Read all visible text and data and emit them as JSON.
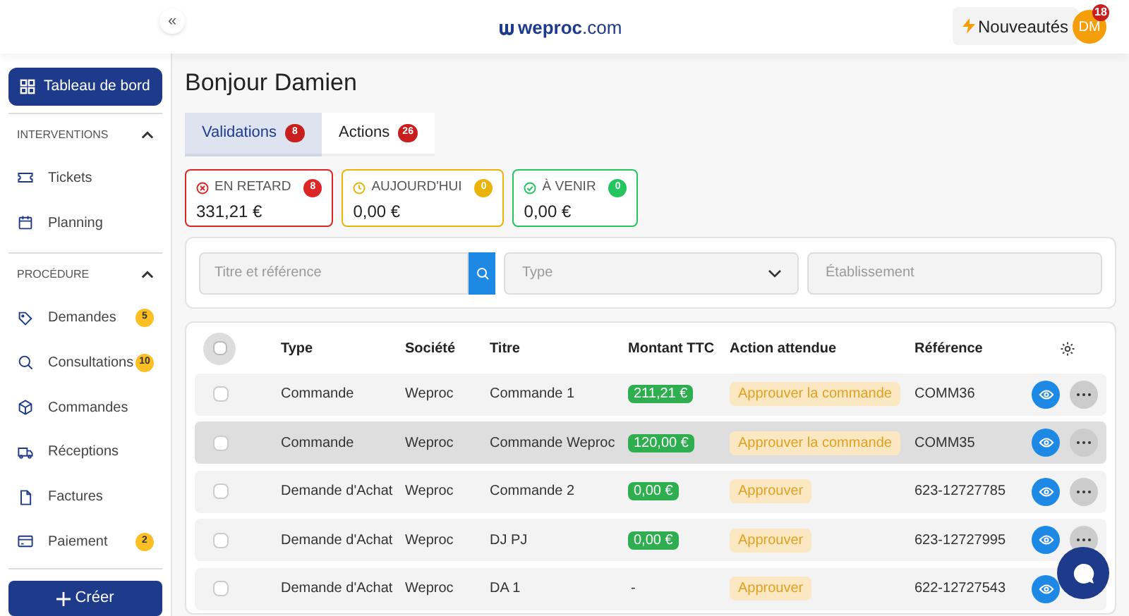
{
  "header": {
    "collapse_label": "«",
    "logo_text": "weproc",
    "logo_domain": ".com",
    "news_button": "Nouveautés",
    "avatar_initials": "DM",
    "avatar_badge": "18"
  },
  "sidebar": {
    "primary": {
      "label": "Tableau de bord",
      "selected": true
    },
    "sections": [
      {
        "title": "INTERVENTIONS",
        "expanded": true,
        "items": [
          {
            "kind": "ticket",
            "label": "Tickets",
            "selected": false
          },
          {
            "kind": "calendar",
            "label": "Planning",
            "selected": false
          }
        ]
      },
      {
        "title": "PROCÉDURE",
        "expanded": true,
        "items": [
          {
            "kind": "tag",
            "label": "Demandes",
            "badge": "5",
            "selected": false
          },
          {
            "kind": "search",
            "label": "Consultations",
            "badge": "10",
            "selected": false
          },
          {
            "kind": "box",
            "label": "Commandes",
            "selected": false
          },
          {
            "kind": "truck",
            "label": "Réceptions",
            "selected": false
          },
          {
            "kind": "file",
            "label": "Factures",
            "selected": false
          },
          {
            "kind": "card",
            "label": "Paiement",
            "badge": "2",
            "selected": false
          }
        ]
      }
    ],
    "create_button": "Créer"
  },
  "greeting": "Bonjour Damien",
  "tabs": [
    {
      "label": "Validations",
      "count": "8",
      "selected": true
    },
    {
      "label": "Actions",
      "count": "26",
      "selected": false
    }
  ],
  "summary_cards": [
    {
      "kind": "late",
      "label": "EN RETARD",
      "count": "8",
      "amount": "331,21 €",
      "color": "#dc2626"
    },
    {
      "kind": "today",
      "label": "AUJOURD'HUI",
      "count": "0",
      "amount": "0,00 €",
      "color": "#eab308"
    },
    {
      "kind": "upcoming",
      "label": "À VENIR",
      "count": "0",
      "amount": "0,00 €",
      "color": "#22c55e"
    }
  ],
  "filters": {
    "search_placeholder": "Titre et référence",
    "type_placeholder": "Type",
    "establishment_placeholder": "Établissement"
  },
  "table": {
    "select_all": {
      "checked": false
    },
    "columns": [
      "Type",
      "Société",
      "Titre",
      "Montant TTC",
      "Action attendue",
      "Référence"
    ],
    "rows": [
      {
        "checked": false,
        "highlighted": false,
        "type": "Commande",
        "company": "Weproc",
        "title": "Commande 1",
        "amount": "211,21 €",
        "amount_badge": true,
        "action": "Approuver la commande",
        "reference": "COMM36",
        "has_menu": true
      },
      {
        "checked": false,
        "highlighted": true,
        "type": "Commande",
        "company": "Weproc",
        "title": "Commande Weproc",
        "amount": "120,00 €",
        "amount_badge": true,
        "action": "Approuver la commande",
        "reference": "COMM35",
        "has_menu": true
      },
      {
        "checked": false,
        "highlighted": false,
        "type": "Demande d'Achat",
        "company": "Weproc",
        "title": "Commande 2",
        "amount": "0,00 €",
        "amount_badge": true,
        "action": "Approuver",
        "reference": "623-12727785",
        "has_menu": true
      },
      {
        "checked": false,
        "highlighted": false,
        "type": "Demande d'Achat",
        "company": "Weproc",
        "title": "DJ PJ",
        "amount": "0,00 €",
        "amount_badge": true,
        "action": "Approuver",
        "reference": "623-12727995",
        "has_menu": true
      },
      {
        "checked": false,
        "highlighted": false,
        "type": "Demande d'Achat",
        "company": "Weproc",
        "title": "DA 1",
        "amount": "-",
        "amount_badge": false,
        "action": "Approuver",
        "reference": "622-12727543",
        "has_menu": false
      }
    ]
  }
}
